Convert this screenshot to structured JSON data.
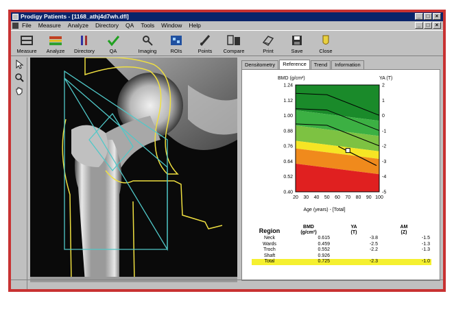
{
  "title": "Prodigy Patients - [1168_athj4d7wh.dfl]",
  "menu": [
    "File",
    "Measure",
    "Analyze",
    "Directory",
    "QA",
    "Tools",
    "Window",
    "Help"
  ],
  "window_buttons": [
    "_",
    "□",
    "×"
  ],
  "toolbar": [
    {
      "label": "Measure",
      "icon": "measure-icon",
      "color": "#303030"
    },
    {
      "label": "Analyze",
      "icon": "analyze-icon",
      "color": "#c04020"
    },
    {
      "label": "Directory",
      "icon": "directory-icon",
      "color": "#3030a0"
    },
    {
      "label": "QA",
      "icon": "qa-check-icon",
      "color": "#20a020"
    },
    {
      "label": "Imaging",
      "icon": "imaging-icon",
      "color": "#303030"
    },
    {
      "label": "ROIs",
      "icon": "rois-icon",
      "color": "#2050a0"
    },
    {
      "label": "Points",
      "icon": "points-icon",
      "color": "#303030"
    },
    {
      "label": "Compare",
      "icon": "compare-icon",
      "color": "#303030"
    },
    {
      "label": "Print",
      "icon": "print-icon",
      "color": "#303030"
    },
    {
      "label": "Save",
      "icon": "save-icon",
      "color": "#303030"
    },
    {
      "label": "Close",
      "icon": "close-doc-icon",
      "color": "#c0a020"
    }
  ],
  "left_tools": [
    "pointer-icon",
    "zoom-icon",
    "pan-hand-icon"
  ],
  "tabs": [
    "Densitometry",
    "Reference",
    "Trend",
    "Information"
  ],
  "active_tab": 1,
  "chart_data": {
    "type": "line",
    "ylabel_left": "BMD (g/cm²)",
    "ylabel_right": "YA (T)",
    "xlabel": "Age (years) - [Total]",
    "x_ticks": [
      20,
      30,
      40,
      50,
      60,
      70,
      80,
      90,
      100
    ],
    "y_ticks_left": [
      "1.24",
      "1.12",
      "1.00",
      "0.88",
      "0.76",
      "0.64",
      "0.52",
      "0.40"
    ],
    "y_ticks_right": [
      "2",
      "1",
      "0",
      "-1",
      "-2",
      "-3",
      "-4",
      "-5"
    ],
    "xlim": [
      20,
      100
    ],
    "ylim": [
      0.4,
      1.24
    ],
    "zone_colors": {
      "dark_green": "#1a8a2a",
      "green": "#3cb043",
      "light_green": "#7dc242",
      "yellow": "#f6e524",
      "orange": "#f08a1c",
      "red": "#e02020"
    },
    "reference_bands": [
      {
        "name": "T ≥ 0",
        "color": "dark_green"
      },
      {
        "name": "0 > T ≥ -1",
        "color": "green"
      },
      {
        "name": "-1 > T ≥ -2",
        "color": "light_green"
      },
      {
        "name": "-2 > T ≥ -2.5",
        "color": "yellow"
      },
      {
        "name": "-2.5 > T ≥ -3.5",
        "color": "orange"
      },
      {
        "name": "T < -3.5",
        "color": "red"
      }
    ],
    "patient_point": {
      "age": 70,
      "bmd": 0.725
    }
  },
  "table": {
    "headers": [
      "Region",
      "BMD\n(g/cm²)",
      "YA\n(T)",
      "AM\n(Z)"
    ],
    "rows": [
      [
        "Neck",
        "0.615",
        "-3.8",
        "-1.5"
      ],
      [
        "Wards",
        "0.459",
        "-2.5",
        "-1.3"
      ],
      [
        "Troch",
        "0.552",
        "-2.2",
        "-1.3"
      ],
      [
        "Shaft",
        "0.926",
        "",
        ""
      ],
      [
        "Total",
        "0.725",
        "-2.3",
        "-1.0"
      ]
    ],
    "highlight_row": 4,
    "highlight_color": "#f5f030"
  }
}
